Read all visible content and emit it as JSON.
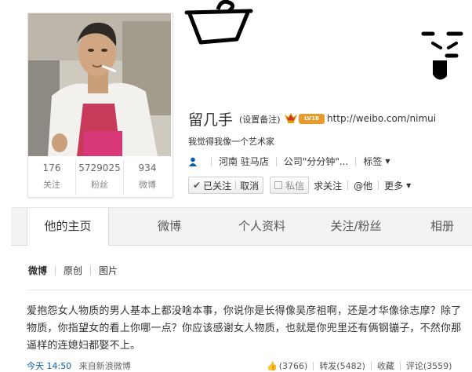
{
  "profile": {
    "name": "留几手",
    "remark": "(设置备注)",
    "level_badge": "LV18",
    "url": "http://weibo.com/nimui",
    "bio": "我觉得我像一个艺术家",
    "location": "河南 驻马店",
    "company": "公司\"分分钟\"...",
    "tags_label": "标签",
    "stats": [
      {
        "num": "176",
        "label": "关注"
      },
      {
        "num": "5729025",
        "label": "粉丝"
      },
      {
        "num": "934",
        "label": "微博"
      }
    ]
  },
  "actions": {
    "followed": "已关注",
    "unfollow": "取消",
    "message": "私信",
    "follow_him": "求关注",
    "at_him": "@他",
    "more": "更多"
  },
  "tabs": [
    "他的主页",
    "微博",
    "个人资料",
    "关注/粉丝",
    "相册"
  ],
  "subnav": [
    "微博",
    "原创",
    "图片"
  ],
  "post": {
    "text": "爱抱怨女人物质的男人基本上都没啥本事，你说你是长得像吴彦祖啊，还是才华像徐志摩？除了物质，你指望女的看上你哪一点？你应该感谢女人物质，也就是你兜里还有俩钢镚子，不然你那逼样的连媳妇都娶不上。",
    "time": "今天 14:50",
    "source": "来自新浪微博",
    "likes": "(3766)",
    "repost": "转发(5482)",
    "favorite": "收藏",
    "comment": "评论(3559)"
  },
  "colors": {
    "link_blue": "#0a5ca8",
    "badge_orange": "#e79b2b",
    "crown_red": "#d0342c"
  }
}
